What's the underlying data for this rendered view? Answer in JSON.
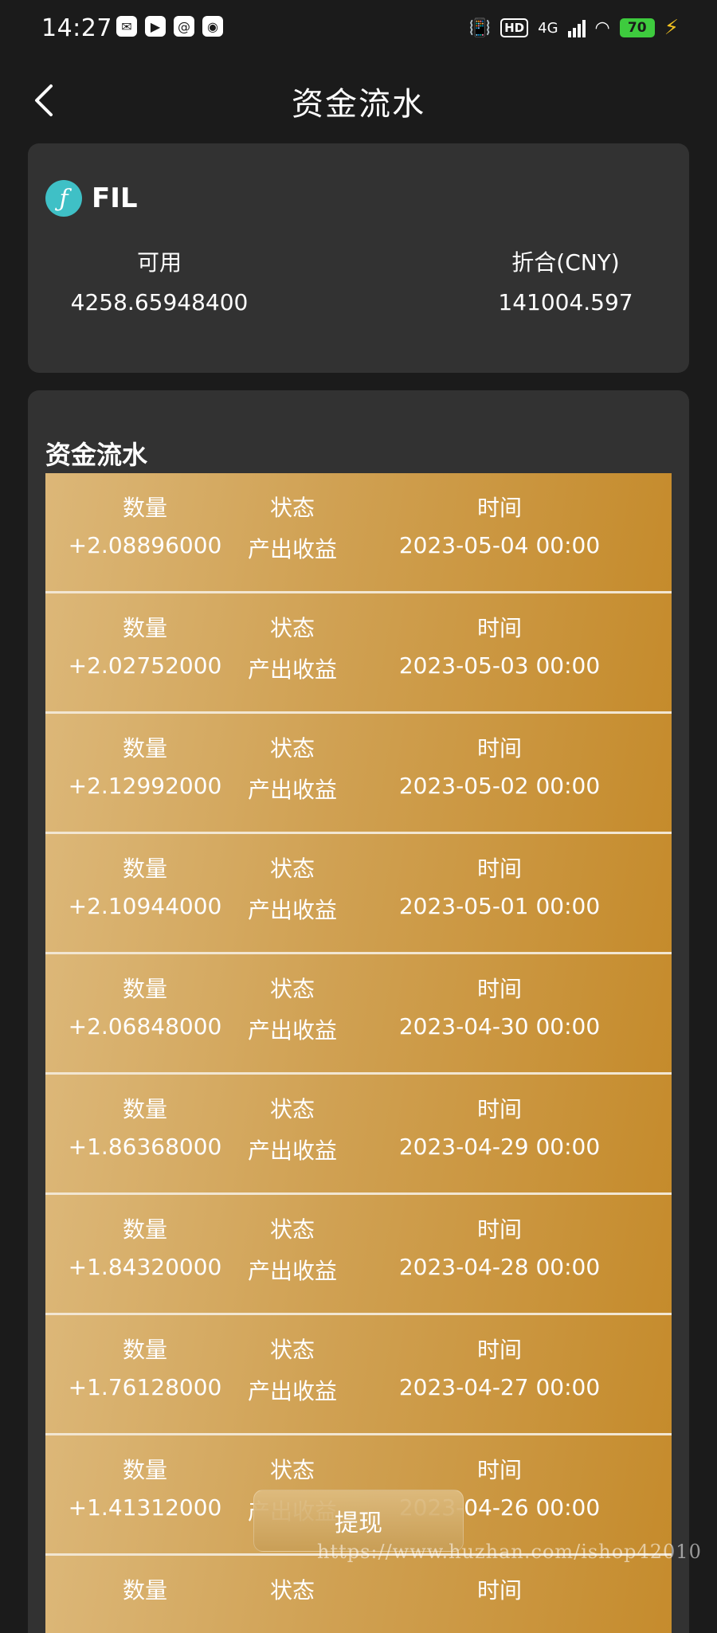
{
  "status_bar": {
    "time": "14:27",
    "network": "4G",
    "hd": "HD",
    "battery": "70"
  },
  "header": {
    "title": "资金流水"
  },
  "asset": {
    "coin": "FIL",
    "available_label": "可用",
    "available_value": "4258.65948400",
    "cny_label": "折合(CNY)",
    "cny_value": "141004.597"
  },
  "flow": {
    "title": "资金流水",
    "col_amount": "数量",
    "col_status": "状态",
    "col_time": "时间",
    "rows": [
      {
        "amount": "+2.08896000",
        "status": "产出收益",
        "time": "2023-05-04 00:00"
      },
      {
        "amount": "+2.02752000",
        "status": "产出收益",
        "time": "2023-05-03 00:00"
      },
      {
        "amount": "+2.12992000",
        "status": "产出收益",
        "time": "2023-05-02 00:00"
      },
      {
        "amount": "+2.10944000",
        "status": "产出收益",
        "time": "2023-05-01 00:00"
      },
      {
        "amount": "+2.06848000",
        "status": "产出收益",
        "time": "2023-04-30 00:00"
      },
      {
        "amount": "+1.86368000",
        "status": "产出收益",
        "time": "2023-04-29 00:00"
      },
      {
        "amount": "+1.84320000",
        "status": "产出收益",
        "time": "2023-04-28 00:00"
      },
      {
        "amount": "+1.76128000",
        "status": "产出收益",
        "time": "2023-04-27 00:00"
      },
      {
        "amount": "+1.41312000",
        "status": "产出收益",
        "time": "2023-04-26 00:00"
      },
      {
        "amount": "",
        "status": "",
        "time": ""
      }
    ]
  },
  "withdraw_label": "提现",
  "watermark": "https://www.huzhan.com/ishop42010",
  "colors": {
    "background": "#1b1b1b",
    "card": "#323232",
    "row_gradient_start": "#dcb778",
    "row_gradient_end": "#c58b2c",
    "coin_logo": "#3fc0c6",
    "battery": "#3ecb3e"
  }
}
